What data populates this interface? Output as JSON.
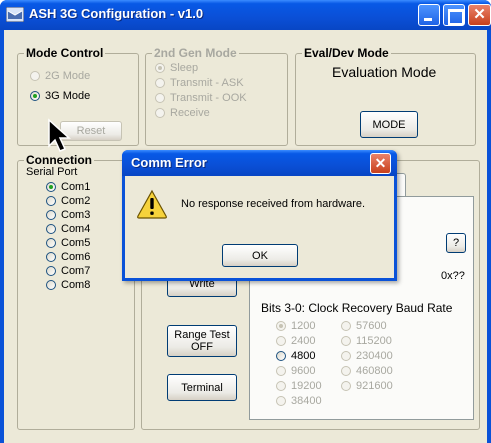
{
  "window": {
    "title": "ASH 3G Configuration - v1.0",
    "controls": {
      "minimize_icon": "minimize-icon",
      "maximize_icon": "maximize-icon",
      "close_glyph": "✕"
    }
  },
  "mode_control": {
    "legend": "Mode Control",
    "options": [
      {
        "label": "2G Mode",
        "checked": false,
        "enabled": false
      },
      {
        "label": "3G Mode",
        "checked": true,
        "enabled": true
      }
    ],
    "reset_button": "Reset"
  },
  "gen2_mode": {
    "legend": "2nd Gen Mode",
    "options": [
      {
        "label": "Sleep",
        "checked": true
      },
      {
        "label": "Transmit - ASK",
        "checked": false
      },
      {
        "label": "Transmit - OOK",
        "checked": false
      },
      {
        "label": "Receive",
        "checked": false
      }
    ]
  },
  "eval_dev": {
    "legend": "Eval/Dev Mode",
    "status": "Evaluation Mode",
    "mode_button": "MODE"
  },
  "connection": {
    "legend": "Connection",
    "serial_port_label": "Serial Port",
    "ports": [
      {
        "label": "Com1",
        "checked": true
      },
      {
        "label": "Com2",
        "checked": false
      },
      {
        "label": "Com3",
        "checked": false
      },
      {
        "label": "Com4",
        "checked": false
      },
      {
        "label": "Com5",
        "checked": false
      },
      {
        "label": "Com6",
        "checked": false
      },
      {
        "label": "Com7",
        "checked": false
      },
      {
        "label": "Com8",
        "checked": false
      }
    ]
  },
  "actions": {
    "write_button": "Write",
    "range_test_button_line1": "Range Test",
    "range_test_button_line2": "OFF",
    "terminal_button": "Terminal"
  },
  "register_panel": {
    "help_button": "?",
    "hex_value": "0x??",
    "baud_heading": "Bits 3-0: Clock Recovery Baud Rate",
    "baud_left": [
      {
        "label": "1200",
        "checked": true,
        "enabled": false
      },
      {
        "label": "2400",
        "checked": false,
        "enabled": false
      },
      {
        "label": "4800",
        "checked": false,
        "enabled": true
      },
      {
        "label": "9600",
        "checked": false,
        "enabled": false
      },
      {
        "label": "19200",
        "checked": false,
        "enabled": false
      },
      {
        "label": "38400",
        "checked": false,
        "enabled": false
      }
    ],
    "baud_right": [
      {
        "label": "57600",
        "checked": false,
        "enabled": false
      },
      {
        "label": "115200",
        "checked": false,
        "enabled": false
      },
      {
        "label": "230400",
        "checked": false,
        "enabled": false
      },
      {
        "label": "460800",
        "checked": false,
        "enabled": false
      },
      {
        "label": "921600",
        "checked": false,
        "enabled": false
      }
    ]
  },
  "dialog": {
    "title": "Comm Error",
    "message": "No response received from hardware.",
    "ok_button": "OK",
    "icon": "warning-icon"
  },
  "colors": {
    "titlebar_blue": "#0a52d8",
    "close_red": "#c8401c",
    "dialog_face": "#ece9d8",
    "radio_checked": "#21a121",
    "disabled_text": "#a8a8a0"
  }
}
